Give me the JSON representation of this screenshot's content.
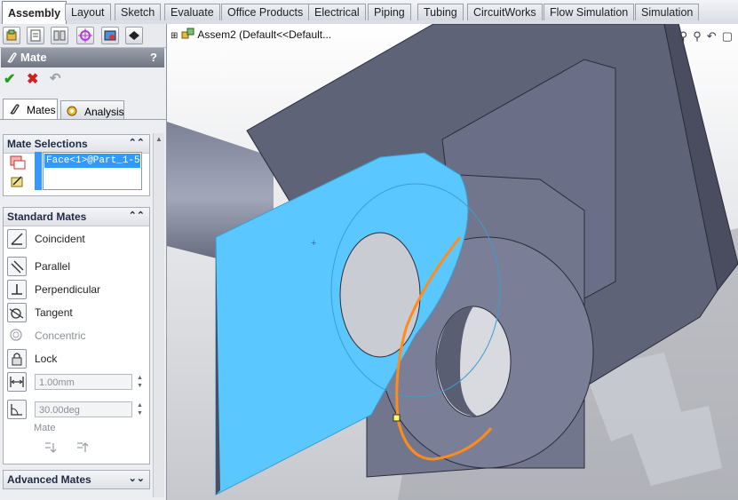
{
  "tabs": [
    {
      "label": "Assembly",
      "active": true
    },
    {
      "label": "Layout"
    },
    {
      "label": "Sketch"
    },
    {
      "label": "Evaluate"
    },
    {
      "label": "Office Products"
    },
    {
      "label": "Electrical"
    },
    {
      "label": "Piping"
    },
    {
      "label": "Tubing"
    },
    {
      "label": "CircuitWorks"
    },
    {
      "label": "Flow Simulation"
    },
    {
      "label": "Simulation"
    }
  ],
  "panel": {
    "title": "Mate",
    "help": "?",
    "subtabs": {
      "mates": "Mates",
      "analysis": "Analysis"
    },
    "mate_selections": {
      "header": "Mate Selections",
      "items": [
        "Face<1>@Part_1-5"
      ]
    },
    "standard_mates": {
      "header": "Standard Mates",
      "coincident": "Coincident",
      "parallel": "Parallel",
      "perpendicular": "Perpendicular",
      "tangent": "Tangent",
      "concentric": "Concentric",
      "lock": "Lock",
      "distance": "1.00mm",
      "angle": "30.00deg",
      "align_caption": "Mate"
    },
    "advanced_mates": {
      "header": "Advanced Mates"
    }
  },
  "tree": {
    "root_label": "Assem2  (Default<<Default..."
  },
  "colors": {
    "selected_face": "#5ac8ff",
    "edge_highlight": "#ff8c1a",
    "part": "#6a6e86",
    "background": "#c9ccd3"
  }
}
